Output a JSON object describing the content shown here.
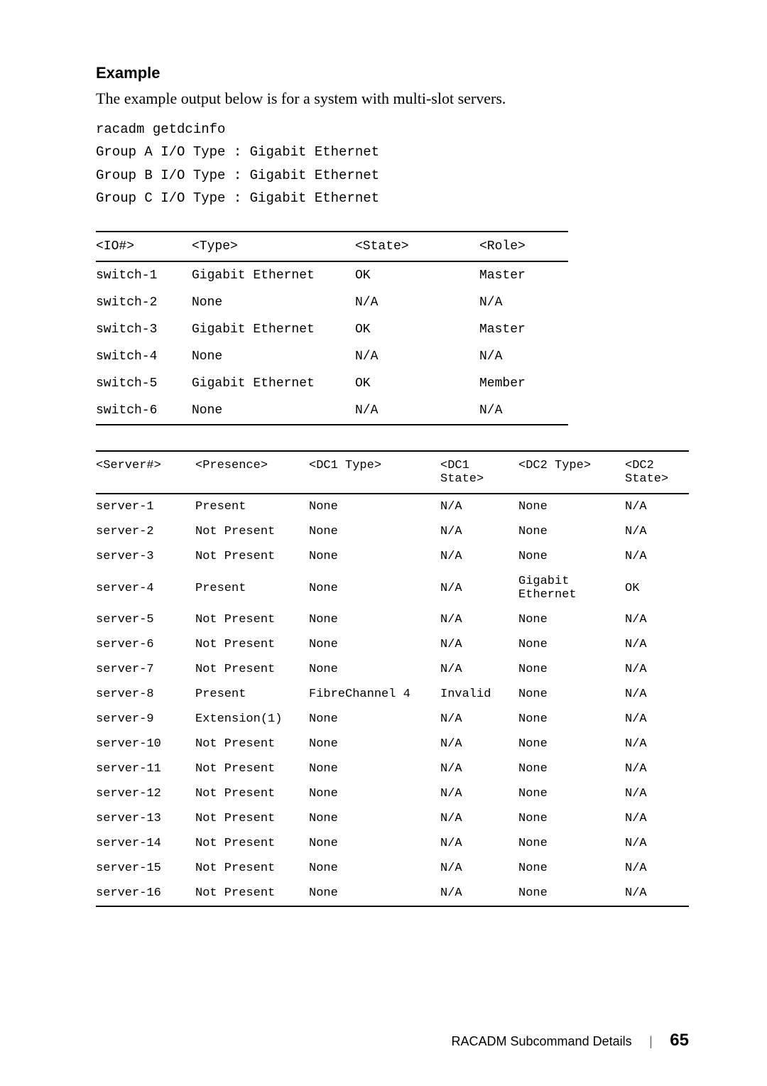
{
  "heading": "Example",
  "intro": "The example output below is for a system with multi-slot servers.",
  "cmd": {
    "line1": "racadm getdcinfo",
    "line2": "Group A I/O Type : Gigabit Ethernet",
    "line3": "Group B I/O Type : Gigabit Ethernet",
    "line4": "Group C I/O Type : Gigabit Ethernet"
  },
  "table1": {
    "headers": {
      "c1": "<IO#>",
      "c2": "<Type>",
      "c3": "<State>",
      "c4": "<Role>"
    },
    "rows": [
      {
        "c1": "switch-1",
        "c2": "Gigabit Ethernet",
        "c3": "OK",
        "c4": "Master"
      },
      {
        "c1": "switch-2",
        "c2": "None",
        "c3": "N/A",
        "c4": "N/A"
      },
      {
        "c1": "switch-3",
        "c2": "Gigabit Ethernet",
        "c3": "OK",
        "c4": "Master"
      },
      {
        "c1": "switch-4",
        "c2": "None",
        "c3": "N/A",
        "c4": "N/A"
      },
      {
        "c1": "switch-5",
        "c2": "Gigabit Ethernet",
        "c3": "OK",
        "c4": "Member"
      },
      {
        "c1": "switch-6",
        "c2": "None",
        "c3": "N/A",
        "c4": "N/A"
      }
    ]
  },
  "table2": {
    "headers": {
      "c1": "<Server#>",
      "c2": "<Presence>",
      "c3": "<DC1 Type>",
      "c4": "<DC1 State>",
      "c5": "<DC2 Type>",
      "c6": "<DC2 State>"
    },
    "rows": [
      {
        "c1": "server-1",
        "c2": "Present",
        "c3": "None",
        "c4": "N/A",
        "c5": "None",
        "c6": "N/A"
      },
      {
        "c1": "server-2",
        "c2": "Not Present",
        "c3": "None",
        "c4": "N/A",
        "c5": "None",
        "c6": "N/A"
      },
      {
        "c1": "server-3",
        "c2": "Not Present",
        "c3": "None",
        "c4": "N/A",
        "c5": "None",
        "c6": "N/A"
      },
      {
        "c1": "server-4",
        "c2": "Present",
        "c3": "None",
        "c4": "N/A",
        "c5": "Gigabit Ethernet",
        "c6": "OK"
      },
      {
        "c1": "server-5",
        "c2": "Not Present",
        "c3": "None",
        "c4": "N/A",
        "c5": "None",
        "c6": "N/A"
      },
      {
        "c1": "server-6",
        "c2": "Not Present",
        "c3": "None",
        "c4": "N/A",
        "c5": "None",
        "c6": "N/A"
      },
      {
        "c1": "server-7",
        "c2": "Not Present",
        "c3": "None",
        "c4": "N/A",
        "c5": "None",
        "c6": "N/A"
      },
      {
        "c1": "server-8",
        "c2": "Present",
        "c3": "FibreChannel 4",
        "c4": "Invalid",
        "c5": "None",
        "c6": "N/A"
      },
      {
        "c1": "server-9",
        "c2": "Extension(1)",
        "c3": "None",
        "c4": "N/A",
        "c5": "None",
        "c6": "N/A"
      },
      {
        "c1": "server-10",
        "c2": "Not Present",
        "c3": "None",
        "c4": "N/A",
        "c5": "None",
        "c6": "N/A"
      },
      {
        "c1": "server-11",
        "c2": "Not Present",
        "c3": "None",
        "c4": "N/A",
        "c5": "None",
        "c6": "N/A"
      },
      {
        "c1": "server-12",
        "c2": "Not Present",
        "c3": "None",
        "c4": "N/A",
        "c5": "None",
        "c6": "N/A"
      },
      {
        "c1": "server-13",
        "c2": "Not Present",
        "c3": "None",
        "c4": "N/A",
        "c5": "None",
        "c6": "N/A"
      },
      {
        "c1": "server-14",
        "c2": "Not Present",
        "c3": "None",
        "c4": "N/A",
        "c5": "None",
        "c6": "N/A"
      },
      {
        "c1": "server-15",
        "c2": "Not Present",
        "c3": "None",
        "c4": "N/A",
        "c5": "None",
        "c6": "N/A"
      },
      {
        "c1": "server-16",
        "c2": "Not Present",
        "c3": "None",
        "c4": "N/A",
        "c5": "None",
        "c6": "N/A"
      }
    ]
  },
  "footer": {
    "section": "RACADM Subcommand Details",
    "page": "65"
  }
}
